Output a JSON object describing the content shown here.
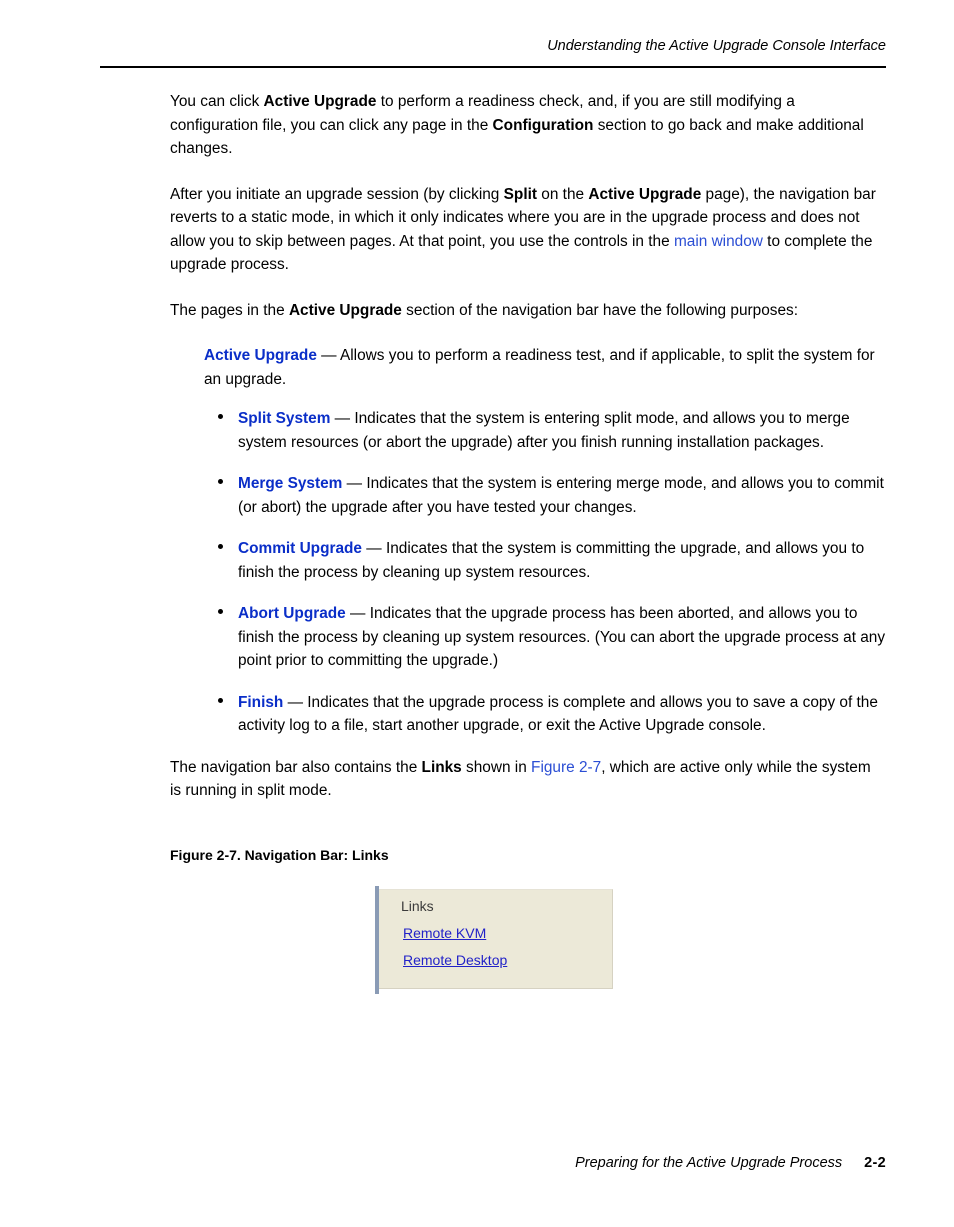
{
  "header": {
    "running_head": "Understanding the Active Upgrade Console Interface"
  },
  "footer": {
    "running_foot": "Preparing for the Active Upgrade Process",
    "page_number": "2-2"
  },
  "paragraphs": {
    "p1_a": "You can click ",
    "p1_b": "Active Upgrade",
    "p1_c": " to perform a readiness check, and, if you are still modifying a configuration file, you can click any page in the ",
    "p1_d": "Configuration",
    "p1_e": " section to go back and make additional changes.",
    "p2_a": "After you initiate an upgrade session (by clicking ",
    "p2_b": "Split",
    "p2_c": " on the ",
    "p2_d": "Active Upgrade",
    "p2_e": " page), the navigation bar reverts to a static mode, in which it only indicates where you are in the upgrade process and does not allow you to skip between pages. At that point, you use the controls in the ",
    "p2_link": "main window",
    "p2_f": " to complete the upgrade process.",
    "p3_a": "The pages in the ",
    "p3_b": "Active Upgrade",
    "p3_c": " section of the navigation bar have the following purposes:",
    "p4_a": "The navigation bar also contains the ",
    "p4_b": "Links",
    "p4_c": " shown in ",
    "p4_link": "Figure 2-7",
    "p4_d": ", which are active only while the system is running in split mode."
  },
  "items": [
    {
      "term": "Active Upgrade",
      "text": " — Allows you to perform a readiness test, and if applicable, to split the system for an upgrade."
    },
    {
      "term": "Split System",
      "text": " — Indicates that the system is entering split mode, and allows you to merge system resources (or abort the upgrade) after you finish running installation packages."
    },
    {
      "term": "Merge System",
      "text": " — Indicates that the system is entering merge mode, and allows you to commit (or abort) the upgrade after you have tested your changes."
    },
    {
      "term": "Commit Upgrade",
      "text": " — Indicates that the system is committing the upgrade, and allows you to finish the process by cleaning up system resources."
    },
    {
      "term": "Abort Upgrade",
      "text": " — Indicates that the upgrade process has been aborted, and allows you to finish the process by cleaning up system resources. (You can abort the upgrade process at any point prior to committing the upgrade.)"
    },
    {
      "term": "Finish",
      "text": " — Indicates that the upgrade process is complete and allows you to save a copy of the activity log to a file, start another upgrade, or exit the Active Upgrade console."
    }
  ],
  "figure": {
    "caption": "Figure 2-7. Navigation Bar: Links",
    "panel": {
      "title": "Links",
      "links": [
        "Remote KVM",
        "Remote Desktop"
      ]
    }
  },
  "colors": {
    "link_blue": "#2b4ed4",
    "term_blue": "#0a2ec8",
    "panel_bg": "#ece9d8",
    "panel_accent": "#8a9bb5"
  }
}
